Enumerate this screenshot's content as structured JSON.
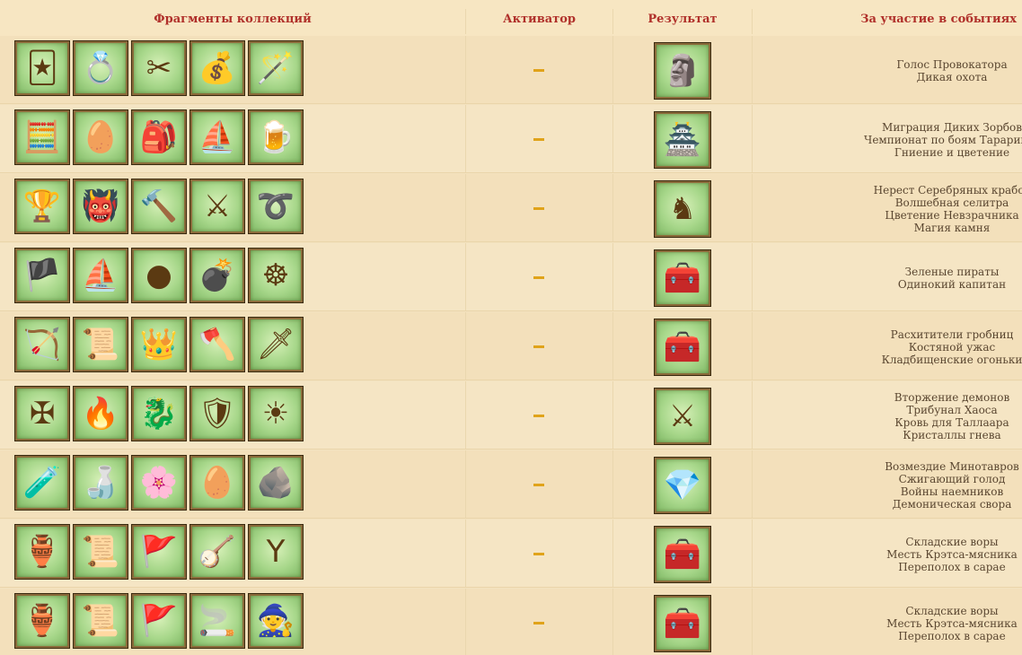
{
  "header": {
    "fragments": "Фрагменты коллекций",
    "activator": "Активатор",
    "result": "Результат",
    "events": "За участие в событиях"
  },
  "rows": [
    {
      "fragments": [
        {
          "icon": "jester-hat-icon",
          "glyph": "🃏"
        },
        {
          "icon": "bracelet-icon",
          "glyph": "💍"
        },
        {
          "icon": "scissors-icon",
          "glyph": "✂"
        },
        {
          "icon": "gold-pot-icon",
          "glyph": "💰"
        },
        {
          "icon": "magic-staff-icon",
          "glyph": "🪄"
        }
      ],
      "activator": "–",
      "result": {
        "icon": "golden-statue-icon",
        "glyph": "🗿"
      },
      "events": [
        "Голос Провокатора",
        "Дикая охота"
      ]
    },
    {
      "fragments": [
        {
          "icon": "abacus-icon",
          "glyph": "🧮"
        },
        {
          "icon": "stone-egg-icon",
          "glyph": "🥚"
        },
        {
          "icon": "cloth-bundle-icon",
          "glyph": "🎒"
        },
        {
          "icon": "ship-in-bottle-icon",
          "glyph": "⛵"
        },
        {
          "icon": "tavern-sign-icon",
          "glyph": "🍺"
        }
      ],
      "activator": "–",
      "result": {
        "icon": "wooden-fort-icon",
        "glyph": "🏯"
      },
      "events": [
        "Миграция Диких Зорбов",
        "Чемпионат по боям Тарариков",
        "Гниение и цветение"
      ]
    },
    {
      "fragments": [
        {
          "icon": "goblet-icon",
          "glyph": "🏆"
        },
        {
          "icon": "demon-mask-icon",
          "glyph": "👹"
        },
        {
          "icon": "hammer-icon",
          "glyph": "🔨"
        },
        {
          "icon": "halberd-icon",
          "glyph": "⚔"
        },
        {
          "icon": "whip-icon",
          "glyph": "➰"
        }
      ],
      "activator": "–",
      "result": {
        "icon": "silver-knight-statue-icon",
        "glyph": "♞"
      },
      "events": [
        "Нерест Серебряных крабов",
        "Волшебная селитра",
        "Цветение Невзрачника",
        "Магия камня"
      ]
    },
    {
      "fragments": [
        {
          "icon": "pirate-flag-icon",
          "glyph": "🏴"
        },
        {
          "icon": "ship-mast-icon",
          "glyph": "⛵"
        },
        {
          "icon": "cannonball-icon",
          "glyph": "●"
        },
        {
          "icon": "cannon-icon",
          "glyph": "💣"
        },
        {
          "icon": "ship-wheel-icon",
          "glyph": "☸"
        }
      ],
      "activator": "–",
      "result": {
        "icon": "green-chest-icon",
        "glyph": "🧰"
      },
      "events": [
        "Зеленые пираты",
        "Одинокий капитан"
      ]
    },
    {
      "fragments": [
        {
          "icon": "bow-and-arrows-icon",
          "glyph": "🏹"
        },
        {
          "icon": "torn-cloth-icon",
          "glyph": "📜"
        },
        {
          "icon": "crown-icon",
          "glyph": "👑"
        },
        {
          "icon": "axe-icon",
          "glyph": "🪓"
        },
        {
          "icon": "sword-icon",
          "glyph": "🗡"
        }
      ],
      "activator": "–",
      "result": {
        "icon": "bone-chest-icon",
        "glyph": "🧰"
      },
      "events": [
        "Расхитители гробниц",
        "Костяной ужас",
        "Кладбищенские огоньки"
      ]
    },
    {
      "fragments": [
        {
          "icon": "demon-cross-icon",
          "glyph": "✠"
        },
        {
          "icon": "flaming-dagger-icon",
          "glyph": "🔥"
        },
        {
          "icon": "fire-dragon-icon",
          "glyph": "🐉"
        },
        {
          "icon": "demon-crest-icon",
          "glyph": "🛡"
        },
        {
          "icon": "eye-sun-icon",
          "glyph": "☀"
        }
      ],
      "activator": "–",
      "result": {
        "icon": "crossed-swords-icon",
        "glyph": "⚔"
      },
      "events": [
        "Вторжение демонов",
        "Трибунал Хаоса",
        "Кровь для Таллаара",
        "Кристаллы гнева"
      ]
    },
    {
      "fragments": [
        {
          "icon": "heart-potion-icon",
          "glyph": "🧪"
        },
        {
          "icon": "bottle-icon",
          "glyph": "🍶"
        },
        {
          "icon": "flower-icon",
          "glyph": "🌸"
        },
        {
          "icon": "turquoise-egg-icon",
          "glyph": "🥚"
        },
        {
          "icon": "ore-pile-icon",
          "glyph": "🪨"
        }
      ],
      "activator": "–",
      "result": {
        "icon": "crystal-chest-icon",
        "glyph": "💎"
      },
      "events": [
        "Возмездие Минотавров",
        "Сжигающий голод",
        "Войны наемников",
        "Демоническая свора"
      ]
    },
    {
      "fragments": [
        {
          "icon": "blue-samovar-icon",
          "glyph": "🏺"
        },
        {
          "icon": "scroll-case-icon",
          "glyph": "📜"
        },
        {
          "icon": "red-banner-icon",
          "glyph": "🚩"
        },
        {
          "icon": "gusli-icon",
          "glyph": "🪕"
        },
        {
          "icon": "slingshot-icon",
          "glyph": "Y"
        }
      ],
      "activator": "–",
      "result": {
        "icon": "red-chest-icon",
        "glyph": "🧰"
      },
      "events": [
        "Складские воры",
        "Месть Крэтса-мясника",
        "Переполох в сарае"
      ]
    },
    {
      "fragments": [
        {
          "icon": "blue-samovar-icon",
          "glyph": "🏺"
        },
        {
          "icon": "scroll-case-icon",
          "glyph": "📜"
        },
        {
          "icon": "red-banner-icon",
          "glyph": "🚩"
        },
        {
          "icon": "smoking-pipe-icon",
          "glyph": "🚬"
        },
        {
          "icon": "monk-statue-icon",
          "glyph": "🧙"
        }
      ],
      "activator": "–",
      "result": {
        "icon": "dark-chest-icon",
        "glyph": "🧰"
      },
      "events": [
        "Складские воры",
        "Месть Крэтса-мясника",
        "Переполох в сарае"
      ]
    }
  ]
}
